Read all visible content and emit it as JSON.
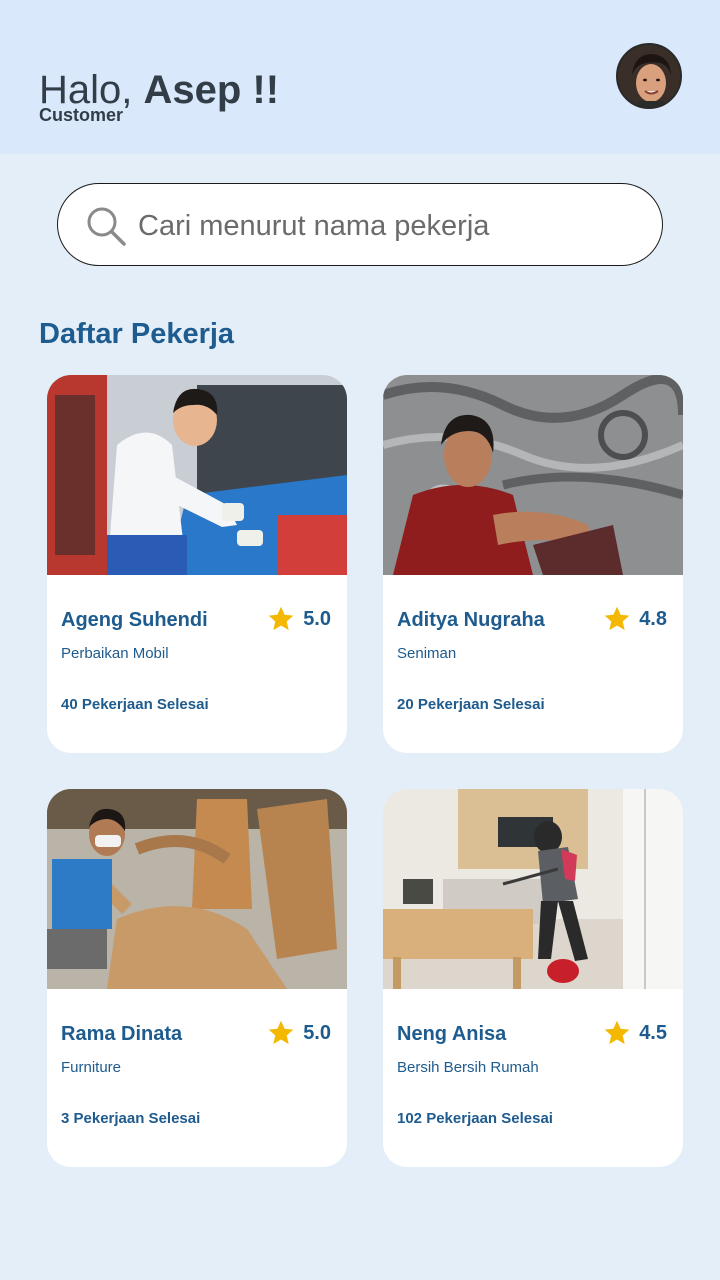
{
  "header": {
    "greeting": "Halo, ",
    "user_name": "Asep !!",
    "role": "Customer"
  },
  "search": {
    "placeholder": "Cari menurut nama pekerja"
  },
  "section_title": "Daftar Pekerja",
  "workers": [
    {
      "name": "Ageng Suhendi",
      "rating": "5.0",
      "job": "Perbaikan Mobil",
      "jobs_done": "40 Pekerjaan Selesai"
    },
    {
      "name": "Aditya Nugraha",
      "rating": "4.8",
      "job": "Seniman",
      "jobs_done": "20 Pekerjaan Selesai"
    },
    {
      "name": "Rama Dinata",
      "rating": "5.0",
      "job": "Furniture",
      "jobs_done": "3 Pekerjaan Selesai"
    },
    {
      "name": "Neng Anisa",
      "rating": "4.5",
      "job": "Bersih Bersih Rumah",
      "jobs_done": "102 Pekerjaan Selesai"
    }
  ],
  "colors": {
    "header_bg": "#d9e9fb",
    "page_bg": "#e4eef9",
    "accent": "#1e5b8e",
    "star": "#f5b800"
  },
  "icons": {
    "search": "search-icon",
    "star": "star-icon"
  }
}
